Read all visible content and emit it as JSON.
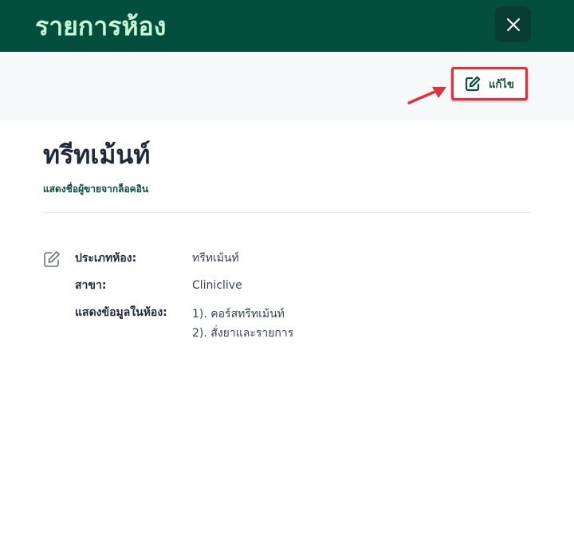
{
  "header": {
    "title": "รายการห้อง",
    "close_icon": "close-icon"
  },
  "toolbar": {
    "edit_label": "แก้ไข",
    "edit_icon": "pencil-square-icon"
  },
  "room": {
    "name": "ทรีทเม้นท์",
    "subtitle": "แสดงชื่อผู้ขายจากล็อคอิน"
  },
  "details": {
    "room_type_label": "ประเภทห้อง:",
    "room_type_value": "ทรีทเม้นท์",
    "branch_label": "สาขา:",
    "branch_value": "Cliniclive",
    "display_label": "แสดงข้อมูลในห้อง:",
    "display_values": [
      "1). คอร์สทรีทเม้นท์",
      "2). สั่งยาและรายการ"
    ]
  },
  "colors": {
    "header_bg": "#044e3e",
    "header_title": "#c6f6d5",
    "accent_green": "#0f4a3c",
    "annotation_red": "#e0313a"
  }
}
